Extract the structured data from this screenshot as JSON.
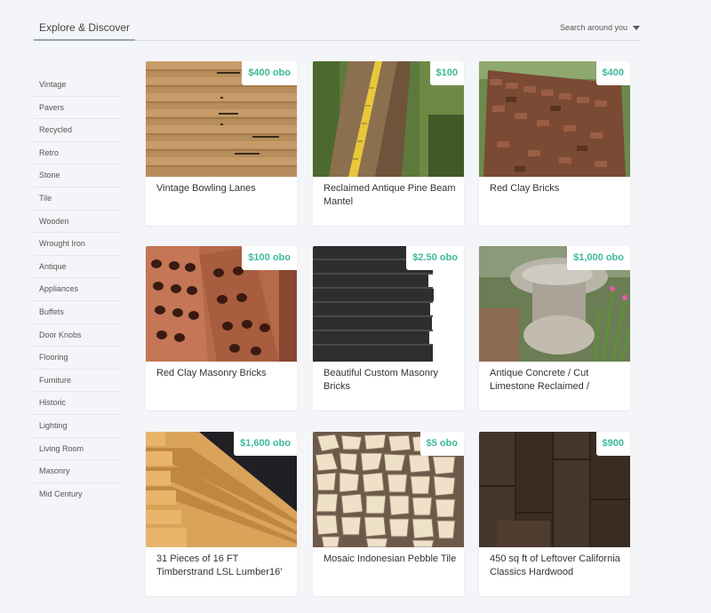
{
  "header": {
    "explore_tab": "Explore & Discover",
    "search_around": "Search around you"
  },
  "sidebar": {
    "items": [
      "Vintage",
      "Pavers",
      "Recycled",
      "Retro",
      "Stone",
      "Tile",
      "Wooden",
      "Wrought Iron",
      "Antique",
      "Appliances",
      "Buffets",
      "Door Knobs",
      "Flooring",
      "Furniture",
      "Historic",
      "Lighting",
      "Living Room",
      "Masonry",
      "Mid Century"
    ]
  },
  "listings": [
    {
      "price": "$400 obo",
      "title": "Vintage Bowling Lanes"
    },
    {
      "price": "$100",
      "title": "Reclaimed Antique Pine Beam Mantel"
    },
    {
      "price": "$400",
      "title": "Red Clay Bricks"
    },
    {
      "price": "$100 obo",
      "title": "Red Clay Masonry Bricks"
    },
    {
      "price": "$2.50 obo",
      "title": "Beautiful Custom Masonry Bricks"
    },
    {
      "price": "$1,000 obo",
      "title": "Antique Concrete / Cut Limestone Reclaimed /"
    },
    {
      "price": "$1,600 obo",
      "title": "31 Pieces of 16 FT Timberstrand LSL Lumber16'"
    },
    {
      "price": "$5 obo",
      "title": "Mosaic Indonesian Pebble Tile"
    },
    {
      "price": "$900",
      "title": "450 sq ft of Leftover California Classics Hardwood"
    }
  ],
  "colors": {
    "price": "#3db89b",
    "background": "#f4f5f8"
  }
}
